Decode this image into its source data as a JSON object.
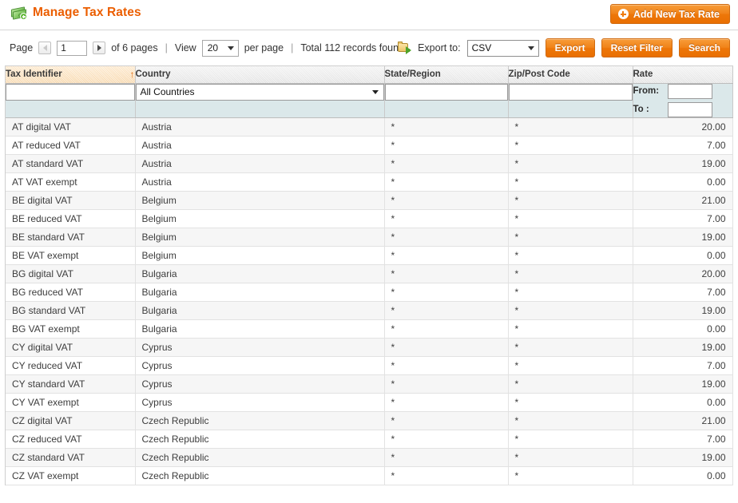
{
  "header": {
    "title": "Manage Tax Rates",
    "icon": "money-add-icon",
    "add_button": "Add New Tax Rate",
    "accent_color": "#eb5e00"
  },
  "toolbar": {
    "page_label": "Page",
    "page_value": "1",
    "of_pages": "of 6 pages",
    "separator": "|",
    "view_label": "View",
    "per_page_value": "20",
    "per_page_label": "per page",
    "total_records": "Total 112 records found",
    "export_icon": "export-folder-icon",
    "export_label": "Export to:",
    "export_format": "CSV",
    "export_button": "Export",
    "reset_filter_button": "Reset Filter",
    "search_button": "Search",
    "prev_arrow": "prev-page-arrow",
    "next_arrow": "next-page-arrow"
  },
  "grid": {
    "columns": [
      {
        "label": "Tax Identifier",
        "sorted": true,
        "sort_dir": "↑"
      },
      {
        "label": "Country",
        "sorted": false,
        "sort_dir": ""
      },
      {
        "label": "State/Region",
        "sorted": false,
        "sort_dir": ""
      },
      {
        "label": "Zip/Post Code",
        "sorted": false,
        "sort_dir": ""
      },
      {
        "label": "Rate",
        "sorted": false,
        "sort_dir": ""
      }
    ],
    "filters": {
      "tax_identifier": "",
      "country": "All Countries",
      "state_region": "",
      "zip_post_code": "",
      "rate_from_label": "From:",
      "rate_from": "",
      "rate_to_label": "To :",
      "rate_to": ""
    },
    "rows": [
      {
        "tax_identifier": "AT digital VAT",
        "country": "Austria",
        "state": "*",
        "zip": "*",
        "rate": "20.00"
      },
      {
        "tax_identifier": "AT reduced VAT",
        "country": "Austria",
        "state": "*",
        "zip": "*",
        "rate": "7.00"
      },
      {
        "tax_identifier": "AT standard VAT",
        "country": "Austria",
        "state": "*",
        "zip": "*",
        "rate": "19.00"
      },
      {
        "tax_identifier": "AT VAT exempt",
        "country": "Austria",
        "state": "*",
        "zip": "*",
        "rate": "0.00"
      },
      {
        "tax_identifier": "BE digital VAT",
        "country": "Belgium",
        "state": "*",
        "zip": "*",
        "rate": "21.00"
      },
      {
        "tax_identifier": "BE reduced VAT",
        "country": "Belgium",
        "state": "*",
        "zip": "*",
        "rate": "7.00"
      },
      {
        "tax_identifier": "BE standard VAT",
        "country": "Belgium",
        "state": "*",
        "zip": "*",
        "rate": "19.00"
      },
      {
        "tax_identifier": "BE VAT exempt",
        "country": "Belgium",
        "state": "*",
        "zip": "*",
        "rate": "0.00"
      },
      {
        "tax_identifier": "BG digital VAT",
        "country": "Bulgaria",
        "state": "*",
        "zip": "*",
        "rate": "20.00"
      },
      {
        "tax_identifier": "BG reduced VAT",
        "country": "Bulgaria",
        "state": "*",
        "zip": "*",
        "rate": "7.00"
      },
      {
        "tax_identifier": "BG standard VAT",
        "country": "Bulgaria",
        "state": "*",
        "zip": "*",
        "rate": "19.00"
      },
      {
        "tax_identifier": "BG VAT exempt",
        "country": "Bulgaria",
        "state": "*",
        "zip": "*",
        "rate": "0.00"
      },
      {
        "tax_identifier": "CY digital VAT",
        "country": "Cyprus",
        "state": "*",
        "zip": "*",
        "rate": "19.00"
      },
      {
        "tax_identifier": "CY reduced VAT",
        "country": "Cyprus",
        "state": "*",
        "zip": "*",
        "rate": "7.00"
      },
      {
        "tax_identifier": "CY standard VAT",
        "country": "Cyprus",
        "state": "*",
        "zip": "*",
        "rate": "19.00"
      },
      {
        "tax_identifier": "CY VAT exempt",
        "country": "Cyprus",
        "state": "*",
        "zip": "*",
        "rate": "0.00"
      },
      {
        "tax_identifier": "CZ digital VAT",
        "country": "Czech Republic",
        "state": "*",
        "zip": "*",
        "rate": "21.00"
      },
      {
        "tax_identifier": "CZ reduced VAT",
        "country": "Czech Republic",
        "state": "*",
        "zip": "*",
        "rate": "7.00"
      },
      {
        "tax_identifier": "CZ standard VAT",
        "country": "Czech Republic",
        "state": "*",
        "zip": "*",
        "rate": "19.00"
      },
      {
        "tax_identifier": "CZ VAT exempt",
        "country": "Czech Republic",
        "state": "*",
        "zip": "*",
        "rate": "0.00"
      }
    ]
  }
}
